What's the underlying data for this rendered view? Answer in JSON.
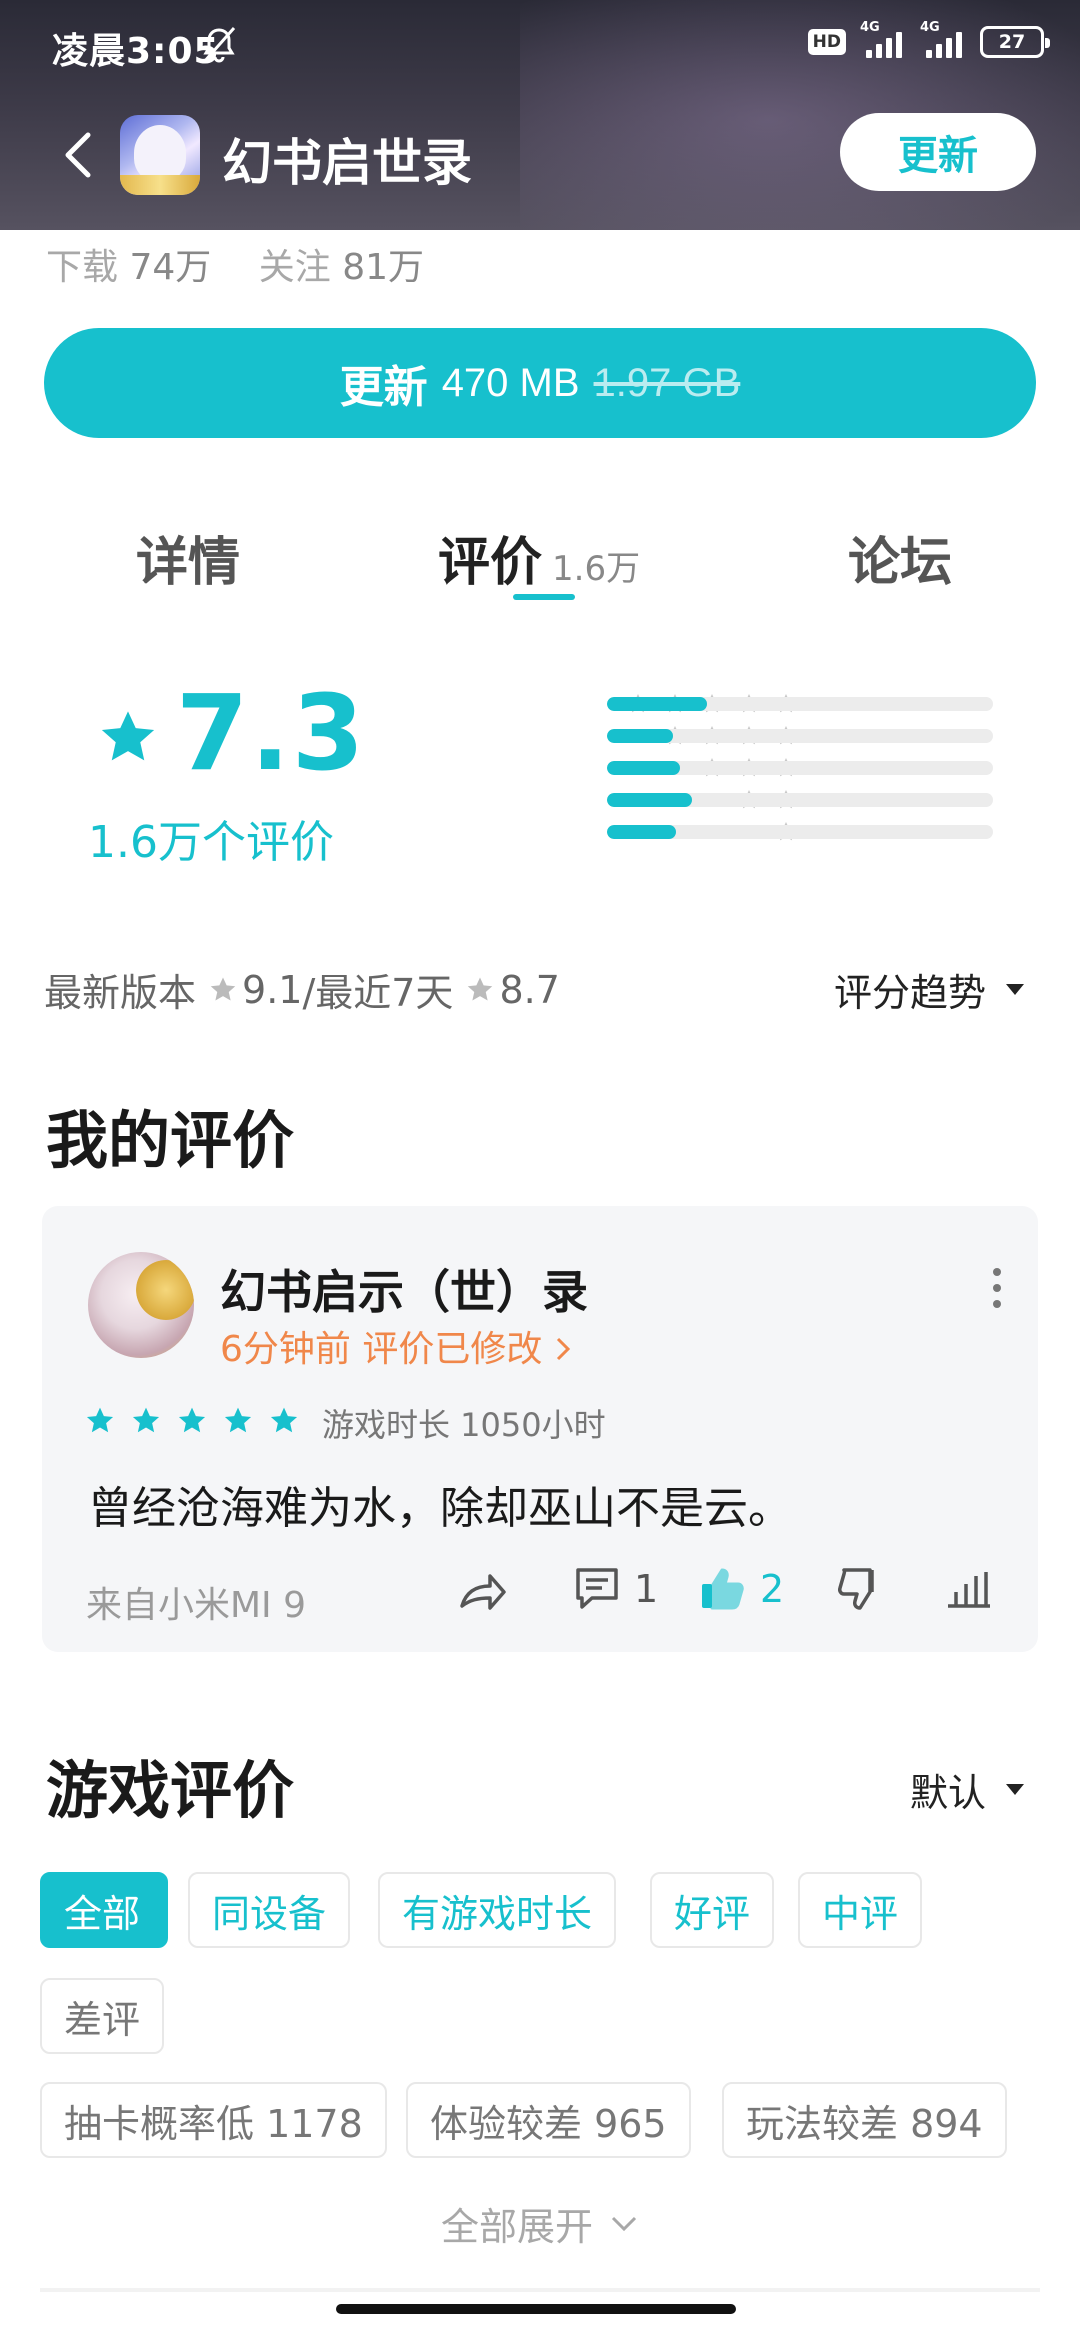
{
  "status_bar": {
    "time": "凌晨3:05",
    "hd": "HD",
    "network_1": "4G",
    "network_2": "4G",
    "battery": "27"
  },
  "header": {
    "title": "幻书启世录",
    "update_label": "更新"
  },
  "stats": {
    "downloads_label": "下载",
    "downloads": "74万",
    "follows_label": "关注",
    "follows": "81万"
  },
  "update_button": {
    "label": "更新",
    "size": "470 MB",
    "old_size": "1.97 GB"
  },
  "tabs": [
    {
      "label": "详情"
    },
    {
      "label": "评价",
      "count": "1.6万"
    },
    {
      "label": "论坛"
    }
  ],
  "rating": {
    "score": "7.3",
    "count_text": "1.6万个评价",
    "distribution": [
      {
        "stars": 5,
        "fraction": 0.26
      },
      {
        "stars": 4,
        "fraction": 0.17
      },
      {
        "stars": 3,
        "fraction": 0.19
      },
      {
        "stars": 2,
        "fraction": 0.22
      },
      {
        "stars": 1,
        "fraction": 0.18
      }
    ],
    "recent_label": "最新版本",
    "recent_version_score": "9.1",
    "recent_days_label": "/最近7天",
    "recent_days_score": "8.7",
    "trend_label": "评分趋势"
  },
  "my_review": {
    "heading": "我的评价",
    "user": "幻书启示（世）录",
    "meta": "6分钟前 评价已修改",
    "stars": 5,
    "playtime": "游戏时长 1050小时",
    "text": "曾经沧海难为水，除却巫山不是云。",
    "device": "来自小米MI 9",
    "comments": "1",
    "likes": "2"
  },
  "game_reviews": {
    "heading": "游戏评价",
    "sort_label": "默认",
    "filters": [
      "全部",
      "同设备",
      "有游戏时长",
      "好评",
      "中评",
      "差评"
    ],
    "tags": [
      "抽卡概率低 1178",
      "体验较差 965",
      "玩法较差 894"
    ],
    "expand_label": "全部展开"
  },
  "colors": {
    "accent": "#17c0cd",
    "orange": "#f0874a"
  }
}
